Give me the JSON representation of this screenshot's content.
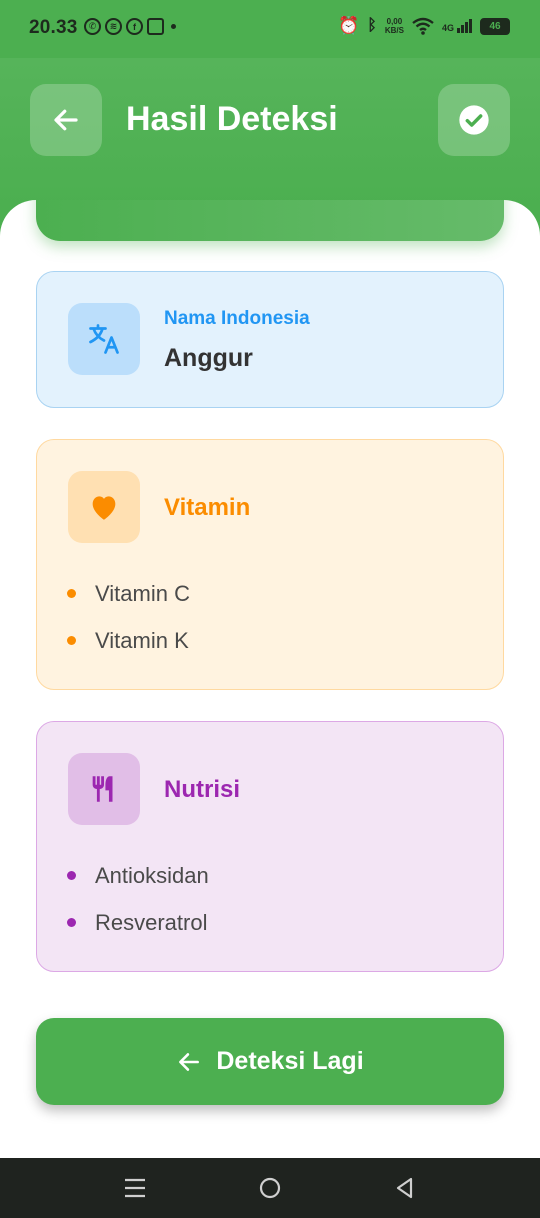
{
  "status": {
    "time": "20.33",
    "net_speed_value": "0,00",
    "net_speed_unit": "KB/S",
    "network": "4G",
    "battery": "46"
  },
  "header": {
    "title": "Hasil Deteksi",
    "back_icon": "arrow-left-icon",
    "confirm_icon": "check-circle-icon"
  },
  "indonesian_name": {
    "label": "Nama Indonesia",
    "value": "Anggur",
    "icon": "translate-icon",
    "color": "#2196F3"
  },
  "vitamin": {
    "title": "Vitamin",
    "icon": "heart-icon",
    "color": "#FB8C00",
    "items": [
      "Vitamin C",
      "Vitamin K"
    ]
  },
  "nutrition": {
    "title": "Nutrisi",
    "icon": "restaurant-icon",
    "color": "#9C27B0",
    "items": [
      "Antioksidan",
      "Resveratrol"
    ]
  },
  "action": {
    "label": "Deteksi Lagi",
    "icon": "arrow-left-icon",
    "color": "#4CAF50"
  },
  "navigation": {
    "icons": [
      "menu-icon",
      "home-icon",
      "back-triangle-icon"
    ]
  }
}
